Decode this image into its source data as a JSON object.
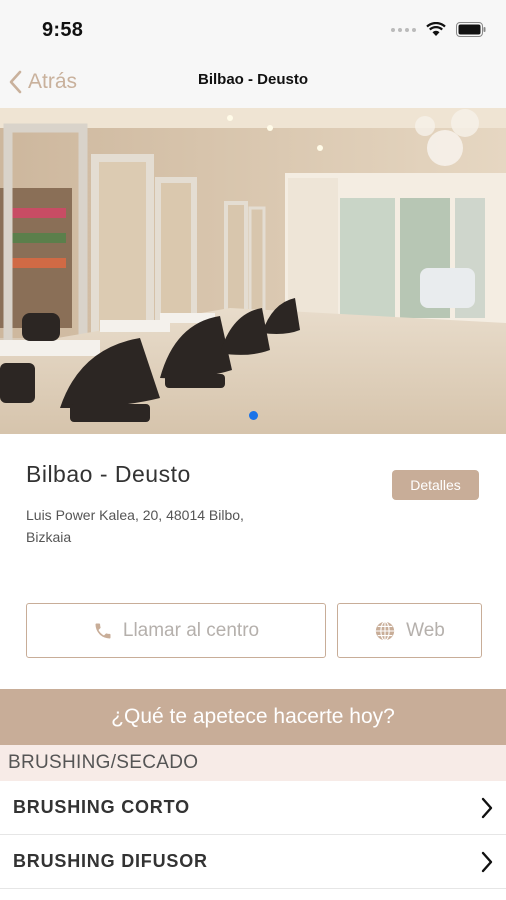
{
  "status_bar": {
    "time": "9:58"
  },
  "nav": {
    "back_label": "Atrás",
    "title": "Bilbao - Deusto"
  },
  "carousel": {
    "current_page": 1,
    "page_count": 1
  },
  "center": {
    "name": "Bilbao - Deusto",
    "details_label": "Detalles",
    "address_lines": [
      "Luis Power Kalea, 20, 48014 Bilbo,",
      "Bizkaia"
    ]
  },
  "actions": {
    "call_label": "Llamar al centro",
    "web_label": "Web"
  },
  "prompt": "¿Qué te apetece hacerte hoy?",
  "category": {
    "name": "BRUSHING/SECADO",
    "services": [
      {
        "label": "BRUSHING CORTO"
      },
      {
        "label": "BRUSHING DIFUSOR"
      }
    ]
  },
  "colors": {
    "accent": "#c8ad98",
    "back_link": "#c9b19c",
    "category_bg": "#f7ebe7",
    "page_dot": "#1a73e8"
  },
  "icons": [
    "signal-icon",
    "wifi-icon",
    "battery-icon",
    "chevron-left-icon",
    "phone-icon",
    "globe-icon",
    "chevron-right-icon"
  ]
}
